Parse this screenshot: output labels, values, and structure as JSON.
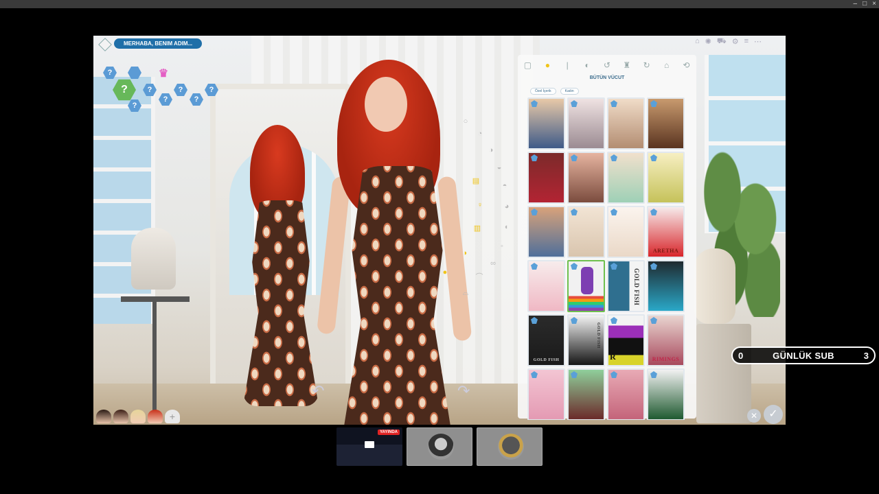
{
  "window": {
    "controls": [
      "–",
      "□",
      "×"
    ]
  },
  "cas": {
    "name_prompt": "MERHABA, BENIM ADIM...",
    "category_label": "BÜTÜN VÜCUT",
    "filters": [
      "Özel İçerik",
      "Kadın"
    ],
    "aspiration_hexes": [
      "?",
      "?",
      "?",
      "?",
      "?",
      "?",
      "?",
      "?"
    ],
    "panel_icons": [
      "▢",
      "●",
      "|",
      "◐",
      "↺",
      "♜",
      "↻",
      "⌂",
      "⟲"
    ],
    "top_icons": [
      "⌂",
      "✺",
      "⛟",
      "⚙",
      "≡",
      "⋯"
    ],
    "tile_brands": {
      "aretha": "ARETHA",
      "gold_fish": "GOLD FISH",
      "gold_fish_2": "GOLD FISH",
      "rimings": "RIMINGS",
      "r_letter": "R",
      "second_brand": "GOLD FISH"
    },
    "cancel": "✕",
    "confirm": "✓"
  },
  "overlay": {
    "sub_left": "0",
    "sub_label": "GÜNLÜK SUB",
    "sub_right": "3"
  },
  "thumbnails": {
    "live_badge": "YAYINDA"
  },
  "colors": {
    "accent_blue": "#1f6fa8",
    "selection_green": "#6ec04e",
    "live_red": "#e02424",
    "hair_red": "#c8301a"
  }
}
